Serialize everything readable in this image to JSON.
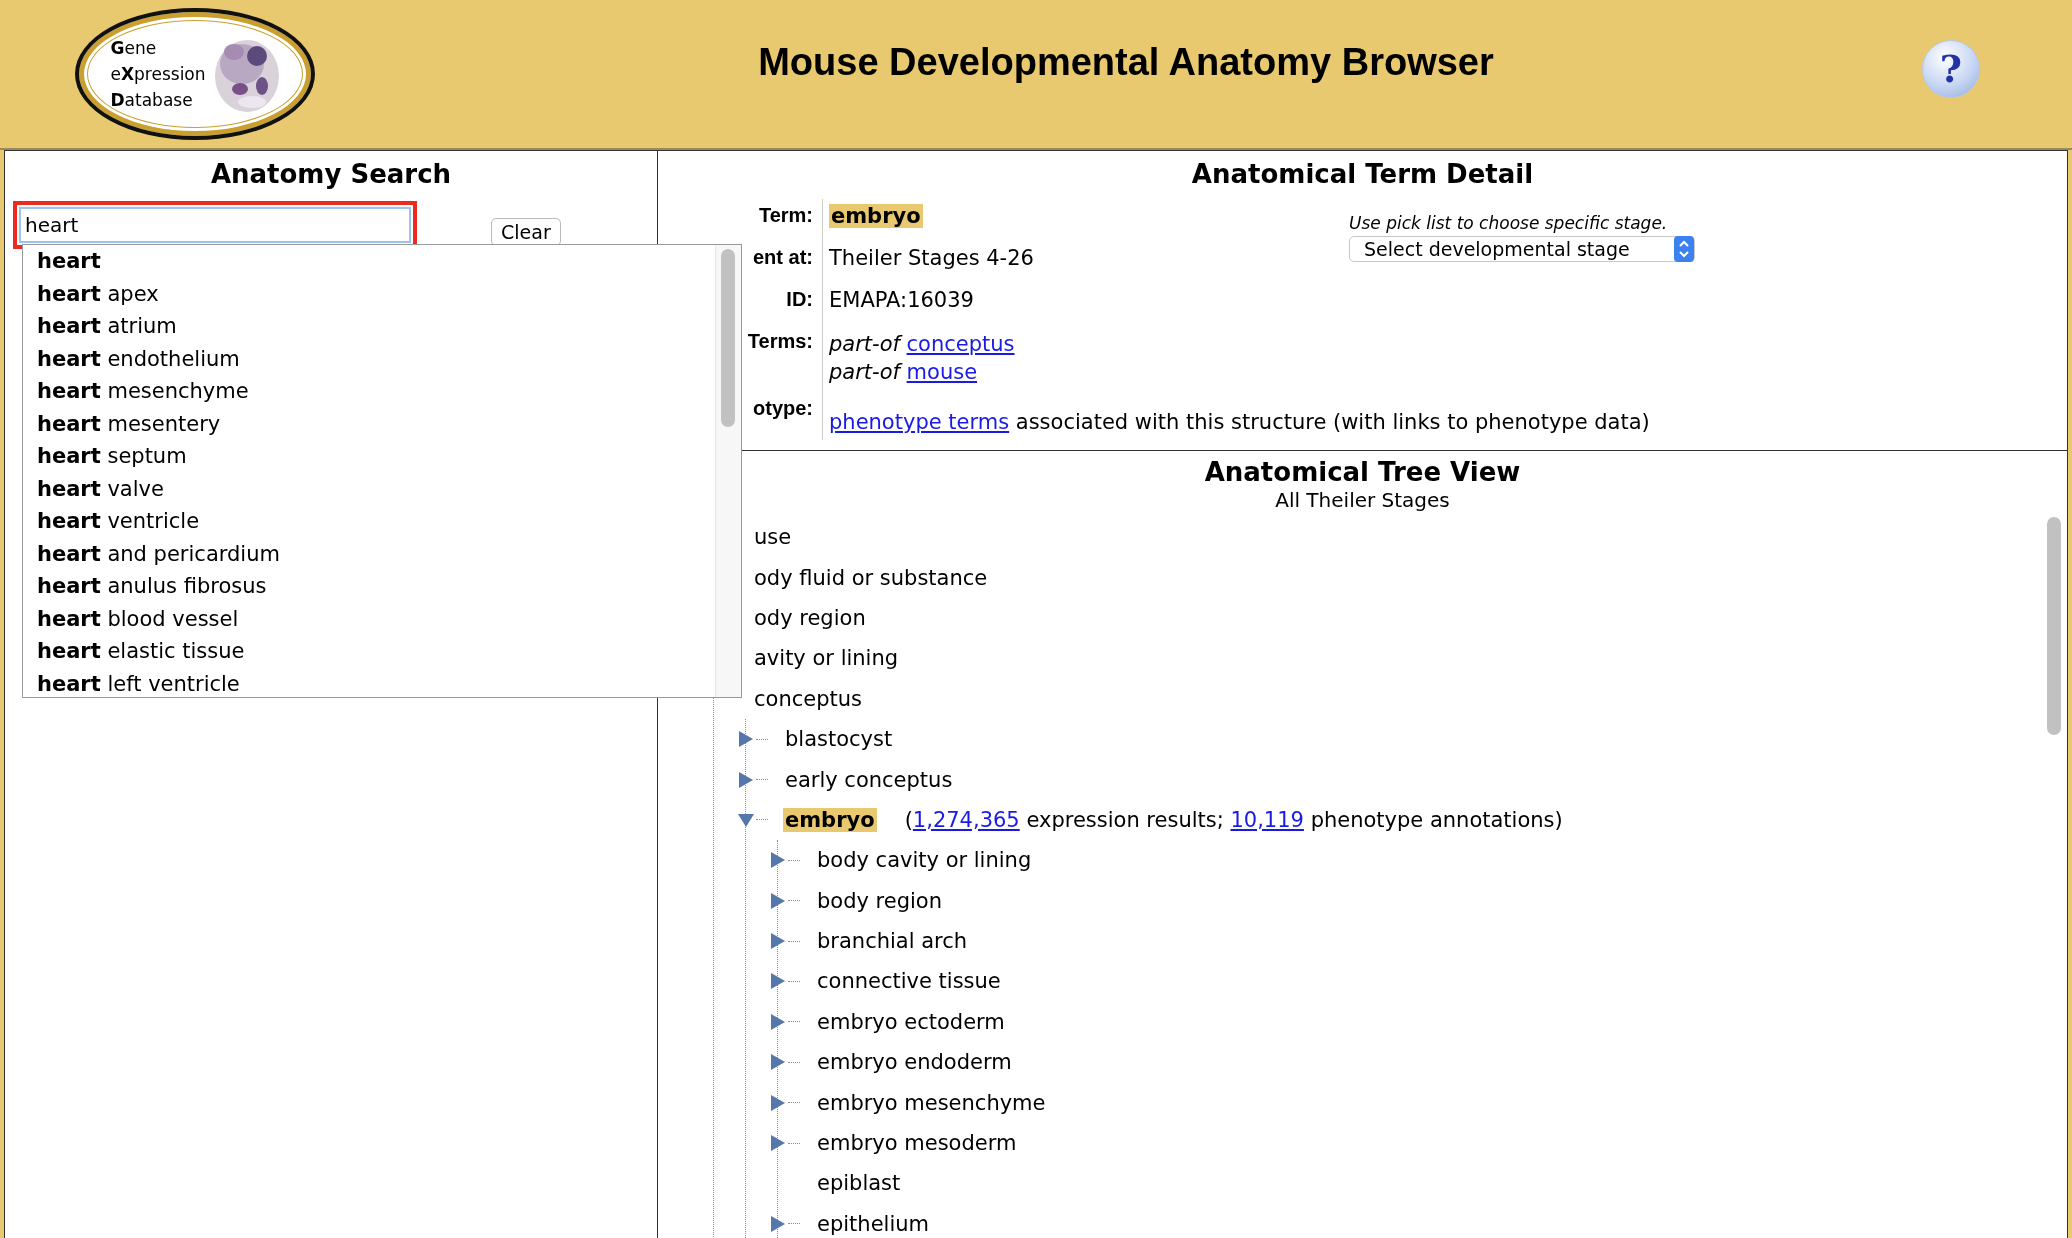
{
  "header": {
    "logo_lines": [
      "**G**ene",
      "e**X**pression",
      "**D**atabase"
    ],
    "title": "Mouse Developmental Anatomy Browser",
    "help_glyph": "?"
  },
  "search_panel": {
    "title": "Anatomy Search",
    "query": "heart",
    "clear_button": "Clear",
    "suggestions": [
      {
        "match": "heart"
      },
      {
        "match": "heart",
        "rest": "apex"
      },
      {
        "match": "heart",
        "rest": "atrium"
      },
      {
        "match": "heart",
        "rest": "endothelium"
      },
      {
        "match": "heart",
        "rest": "mesenchyme"
      },
      {
        "match": "heart",
        "rest": "mesentery"
      },
      {
        "match": "heart",
        "rest": "septum"
      },
      {
        "match": "heart",
        "rest": "valve"
      },
      {
        "match": "heart",
        "rest": "ventricle"
      },
      {
        "match": "heart",
        "rest": "and pericardium"
      },
      {
        "match": "heart",
        "rest": "anulus fibrosus"
      },
      {
        "match": "heart",
        "rest": "blood vessel"
      },
      {
        "match": "heart",
        "rest": "elastic tissue"
      },
      {
        "match": "heart",
        "rest": "left ventricle"
      }
    ]
  },
  "detail_panel": {
    "title": "Anatomical Term Detail",
    "fields": [
      {
        "label": "Term:",
        "kind": "term",
        "value": "embryo"
      },
      {
        "label": "ent at:",
        "kind": "text",
        "value": "Theiler Stages 4-26"
      },
      {
        "label": "ID:",
        "kind": "text",
        "value": "EMAPA:16039"
      },
      {
        "label": "Terms:",
        "kind": "relations",
        "relations": [
          {
            "relation": "part-of",
            "link": "conceptus"
          },
          {
            "relation": "part-of",
            "link": "mouse"
          }
        ]
      },
      {
        "label": "otype:",
        "kind": "phenotype",
        "link": "phenotype terms",
        "text": "associated with this structure (with links to phenotype data)"
      }
    ],
    "stage_picker": {
      "hint": "Use pick list to choose specific stage.",
      "value": "Select developmental stage"
    }
  },
  "tree_panel": {
    "title": "Anatomical Tree View",
    "subtitle": "All Theiler Stages",
    "nodes": [
      {
        "label": "use"
      },
      {
        "label": "ody fluid or substance"
      },
      {
        "label": "ody region"
      },
      {
        "label": "avity or lining"
      },
      {
        "label": "conceptus",
        "children": [
          {
            "label": "blastocyst",
            "expanded": false
          },
          {
            "label": "early conceptus",
            "expanded": false
          },
          {
            "label": "embryo",
            "expanded": true,
            "highlighted": true,
            "note": [
              {
                "text": "("
              },
              {
                "text": "1,274,365",
                "link": true
              },
              {
                "text": " expression results; "
              },
              {
                "text": "10,119",
                "link": true
              },
              {
                "text": " phenotype annotations)"
              }
            ],
            "children": [
              {
                "label": "body cavity or lining",
                "expanded": false
              },
              {
                "label": "body region",
                "expanded": false
              },
              {
                "label": "branchial arch",
                "expanded": false
              },
              {
                "label": "connective tissue",
                "expanded": false
              },
              {
                "label": "embryo ectoderm",
                "expanded": false
              },
              {
                "label": "embryo endoderm",
                "expanded": false
              },
              {
                "label": "embryo mesenchyme",
                "expanded": false
              },
              {
                "label": "embryo mesoderm",
                "expanded": false
              },
              {
                "label": "epiblast"
              },
              {
                "label": "epithelium",
                "expanded": false
              }
            ]
          }
        ]
      }
    ]
  }
}
